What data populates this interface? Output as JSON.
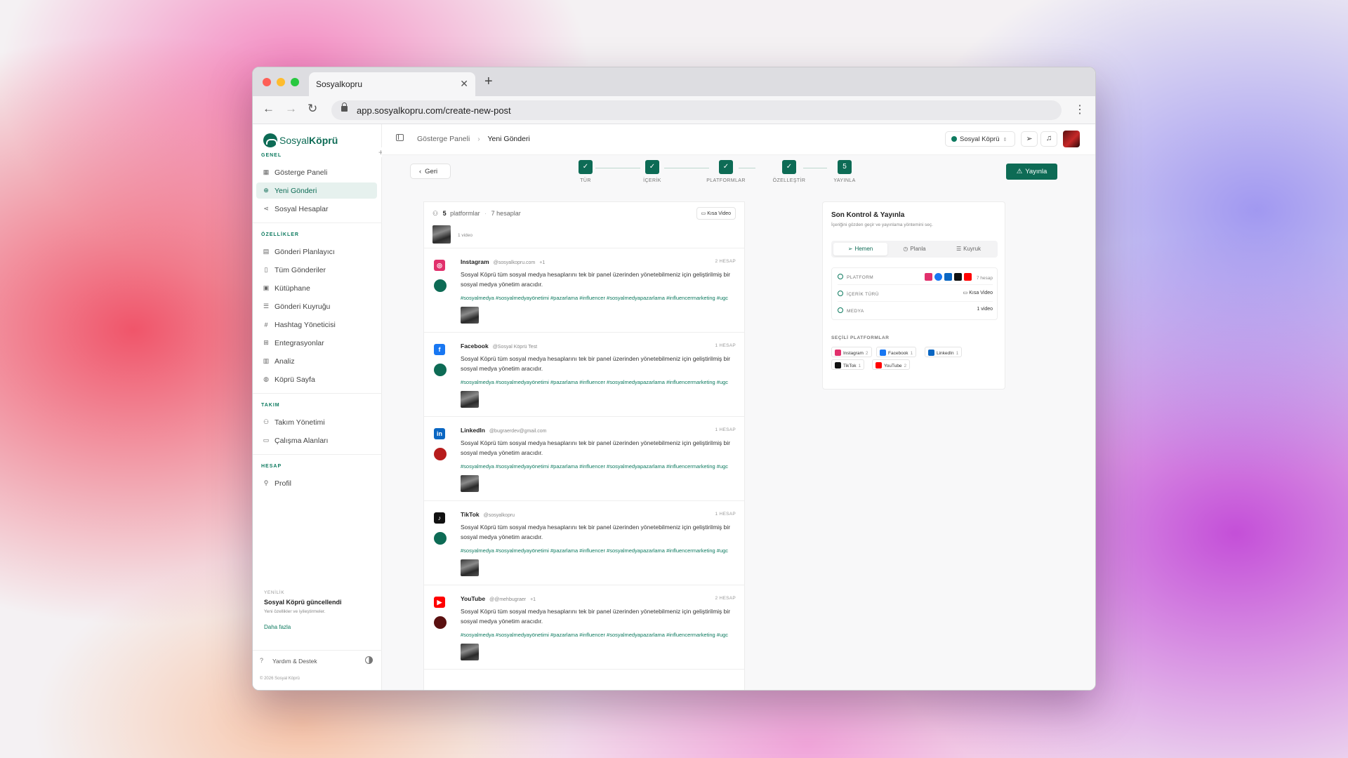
{
  "browser": {
    "tab_title": "Sosyalkopru",
    "url": "app.sosyalkopru.com/create-new-post"
  },
  "sidebar": {
    "logo_a": "Sosyal",
    "logo_b": "Köprü",
    "sections": {
      "genel": "GENEL",
      "ozellikler": "ÖZELLİKLER",
      "takim": "TAKIM",
      "hesap": "HESAP"
    },
    "items": [
      "Gösterge Paneli",
      "Yeni Gönderi",
      "Sosyal Hesaplar",
      "Gönderi Planlayıcı",
      "Tüm Gönderiler",
      "Kütüphane",
      "Gönderi Kuyruğu",
      "Hashtag Yöneticisi",
      "Entegrasyonlar",
      "Analiz",
      "Köprü Sayfa",
      "Takım Yönetimi",
      "Çalışma Alanları",
      "Profil"
    ],
    "news": {
      "label": "YENİLİK",
      "title": "Sosyal Köprü güncellendi",
      "desc": "Yeni özellikler ve iyileştirmeler.",
      "more": "Daha fazla"
    },
    "help": "Yardım & Destek",
    "copyright": "© 2026 Sosyal Köprü"
  },
  "topbar": {
    "crumb1": "Gösterge Paneli",
    "crumb2": "Yeni Gönderi",
    "account": "Sosyal Köprü"
  },
  "wizard": {
    "back": "Geri",
    "steps": [
      {
        "label": "TÜR",
        "mark": "✓"
      },
      {
        "label": "İÇERİK",
        "mark": "✓"
      },
      {
        "label": "PLATFORMLAR",
        "mark": "✓"
      },
      {
        "label": "ÖZELLEŞTİR",
        "mark": "✓"
      },
      {
        "label": "YAYINLA",
        "mark": "5"
      }
    ],
    "publish": "Yayınla"
  },
  "preview": {
    "platform_count": "5",
    "platform_label": "platformlar",
    "accounts": "7 hesaplar",
    "format": "Kısa Video",
    "media": "1 video"
  },
  "posts": [
    {
      "platform": "Instagram",
      "handle": "@sosyalkopru.com",
      "extra": "+1",
      "count": "2 HESAP",
      "color": "#e1306c",
      "glyph": "◎",
      "avatar": "#0d6b55"
    },
    {
      "platform": "Facebook",
      "handle": "@Sosyal Köprü Test",
      "extra": "",
      "count": "1 HESAP",
      "color": "#1877f2",
      "glyph": "f",
      "avatar": "#0d6b55"
    },
    {
      "platform": "LinkedIn",
      "handle": "@bugraerdev@gmail.com",
      "extra": "",
      "count": "1 HESAP",
      "color": "#0a66c2",
      "glyph": "in",
      "avatar": "#b71c1c"
    },
    {
      "platform": "TikTok",
      "handle": "@sosyalkopru",
      "extra": "",
      "count": "1 HESAP",
      "color": "#111111",
      "glyph": "♪",
      "avatar": "#0d6b55"
    },
    {
      "platform": "YouTube",
      "handle": "@@mehbugraer",
      "extra": "+1",
      "count": "2 HESAP",
      "color": "#ff0000",
      "glyph": "▶",
      "avatar": "#5a1010"
    }
  ],
  "post_text": "Sosyal Köprü tüm sosyal medya hesaplarını tek bir panel üzerinden yönetebilmeniz için geliştirilmiş bir sosyal medya yönetim aracıdır.",
  "post_tags": "#sosyalmedya #sosyalmedyayönetimi #pazarlama #influencer #sosyalmedyapazarlama #influencermarketing #ugc",
  "summary": {
    "title": "Son Kontrol & Yayınla",
    "subtitle": "İçeriğini gözden geçir ve yayınlama yöntemini seç.",
    "tabs": [
      "Hemen",
      "Planla",
      "Kuyruk"
    ],
    "platform_label": "PLATFORM",
    "platform_value": "7 hesap",
    "type_label": "İÇERİK TÜRÜ",
    "type_value": "Kısa Video",
    "media_label": "MEDYA",
    "media_value": "1 video",
    "selected_label": "SEÇİLİ PLATFORMLAR",
    "selected": [
      {
        "name": "Instagram",
        "n": "2"
      },
      {
        "name": "Facebook",
        "n": "1"
      },
      {
        "name": "LinkedIn",
        "n": "1"
      },
      {
        "name": "TikTok",
        "n": "1"
      },
      {
        "name": "YouTube",
        "n": "2"
      }
    ]
  },
  "colors": {
    "brand": "#0d6b55",
    "instagram": "#e1306c",
    "facebook": "#1877f2",
    "linkedin": "#0a66c2",
    "tiktok": "#111111",
    "youtube": "#ff0000"
  }
}
